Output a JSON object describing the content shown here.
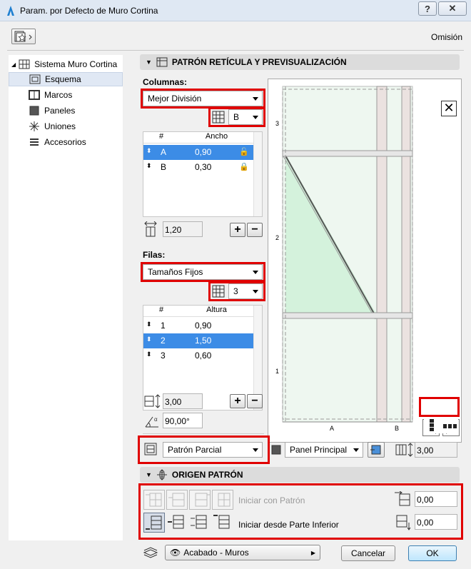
{
  "window": {
    "title": "Param. por Defecto de Muro Cortina",
    "help": "?",
    "close": "✕"
  },
  "header": {
    "omision": "Omisión"
  },
  "tree": {
    "root": "Sistema Muro Cortina",
    "items": [
      {
        "label": "Esquema",
        "icon": "scheme-icon",
        "selected": true
      },
      {
        "label": "Marcos",
        "icon": "frames-icon"
      },
      {
        "label": "Paneles",
        "icon": "panels-icon"
      },
      {
        "label": "Uniones",
        "icon": "junctions-icon"
      },
      {
        "label": "Accesorios",
        "icon": "accessories-icon"
      }
    ]
  },
  "grid_section": {
    "title": "PATRÓN RETÍCULA Y PREVISUALIZACIÓN",
    "columns_label": "Columnas:",
    "columns_mode": "Mejor División",
    "columns_letter": "B",
    "columns_table": {
      "headers": [
        "#",
        "Ancho"
      ],
      "rows": [
        {
          "id": "A",
          "value": "0,90",
          "selected": true
        },
        {
          "id": "B",
          "value": "0,30",
          "selected": false
        }
      ]
    },
    "columns_total": "1,20",
    "rows_label": "Filas:",
    "rows_mode": "Tamaños Fijos",
    "rows_count": "3",
    "rows_table": {
      "headers": [
        "#",
        "Altura"
      ],
      "rows": [
        {
          "id": "1",
          "value": "0,90",
          "selected": false
        },
        {
          "id": "2",
          "value": "1,50",
          "selected": true
        },
        {
          "id": "3",
          "value": "0,60",
          "selected": false
        }
      ]
    },
    "rows_total": "3,00",
    "angle": "90,00°",
    "pattern_mode": "Patrón Parcial",
    "panel_type": "Panel Principal",
    "panel_value": "3,00",
    "preview": {
      "row_labels": [
        "3",
        "2",
        "1"
      ],
      "col_labels": [
        "A",
        "B"
      ]
    }
  },
  "origin_section": {
    "title": "ORIGEN PATRÓN",
    "start_pattern": "Iniciar con Patrón",
    "start_bottom": "Iniciar desde Parte Inferior",
    "value1": "0,00",
    "value2": "0,00"
  },
  "footer": {
    "surface": "Acabado - Muros",
    "cancel": "Cancelar",
    "ok": "OK"
  },
  "colors": {
    "highlight": "#e00000",
    "selection": "#3c8ce6",
    "panel_green": "#d4f2dc"
  }
}
